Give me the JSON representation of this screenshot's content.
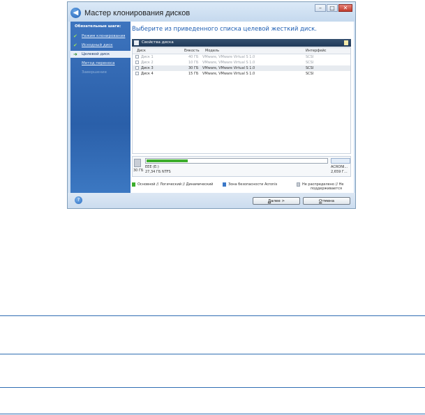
{
  "window": {
    "title": "Мастер клонирования дисков",
    "controls": {
      "minimize": "–",
      "maximize": "□",
      "close": "✕"
    }
  },
  "sidebar": {
    "heading": "Обязательные шаги:",
    "items": [
      {
        "label": "Режим клонирования",
        "state": "done"
      },
      {
        "label": "Исходный диск",
        "state": "done"
      },
      {
        "label": "Целевой диск",
        "state": "active"
      },
      {
        "label": "Метод переноса",
        "state": "link"
      },
      {
        "label": "Завершение",
        "state": "disabled"
      }
    ]
  },
  "main": {
    "heading": "Выберите из приведенного списка целевой жесткий диск.",
    "panel_title": "Свойства диска"
  },
  "table": {
    "columns": [
      "Диск",
      "Емкость",
      "Модель",
      "Интерфейс"
    ],
    "rows": [
      {
        "disk": "Диск 1",
        "capacity": "40 ГБ",
        "model": "VMware, VMware Virtual S 1.0",
        "iface": "SCSI",
        "state": "disabled"
      },
      {
        "disk": "Диск 2",
        "capacity": "10 ГБ",
        "model": "VMware, VMware Virtual S 1.0",
        "iface": "SCSI",
        "state": "disabled"
      },
      {
        "disk": "Диск 3",
        "capacity": "30 ГБ",
        "model": "VMware, VMware Virtual S 1.0",
        "iface": "SCSI",
        "state": "selected"
      },
      {
        "disk": "Диск 4",
        "capacity": "15 ГБ",
        "model": "VMware, VMware Virtual S 1.0",
        "iface": "SCSI",
        "state": "normal"
      }
    ]
  },
  "diskmap": {
    "size": "30 ГБ",
    "partition_name": "EEE (E:)",
    "partition_info": "27,34 ГБ  NTFS",
    "partition_used_fraction": 0.23,
    "acronis_name": "ACRONI...",
    "acronis_size": "2,659 Г..."
  },
  "legend": {
    "primary": "Основной // Логический // Динамический",
    "acronis_zone": "Зона безопасности Acronis",
    "unallocated_line1": "Не распределено // Не",
    "unallocated_line2": "поддерживается",
    "colors": {
      "primary": "#3cad2c",
      "acronis": "#3b78c8",
      "unallocated": "#c8ccd2"
    }
  },
  "buttons": {
    "next_hotkey": "Д",
    "next_rest": "алее >",
    "cancel_hotkey": "О",
    "cancel_rest": "тмена"
  },
  "colors": {
    "accent": "#1f5fb3",
    "sidebar": "#2f66b0",
    "rule_lines": "#2f6db2"
  }
}
